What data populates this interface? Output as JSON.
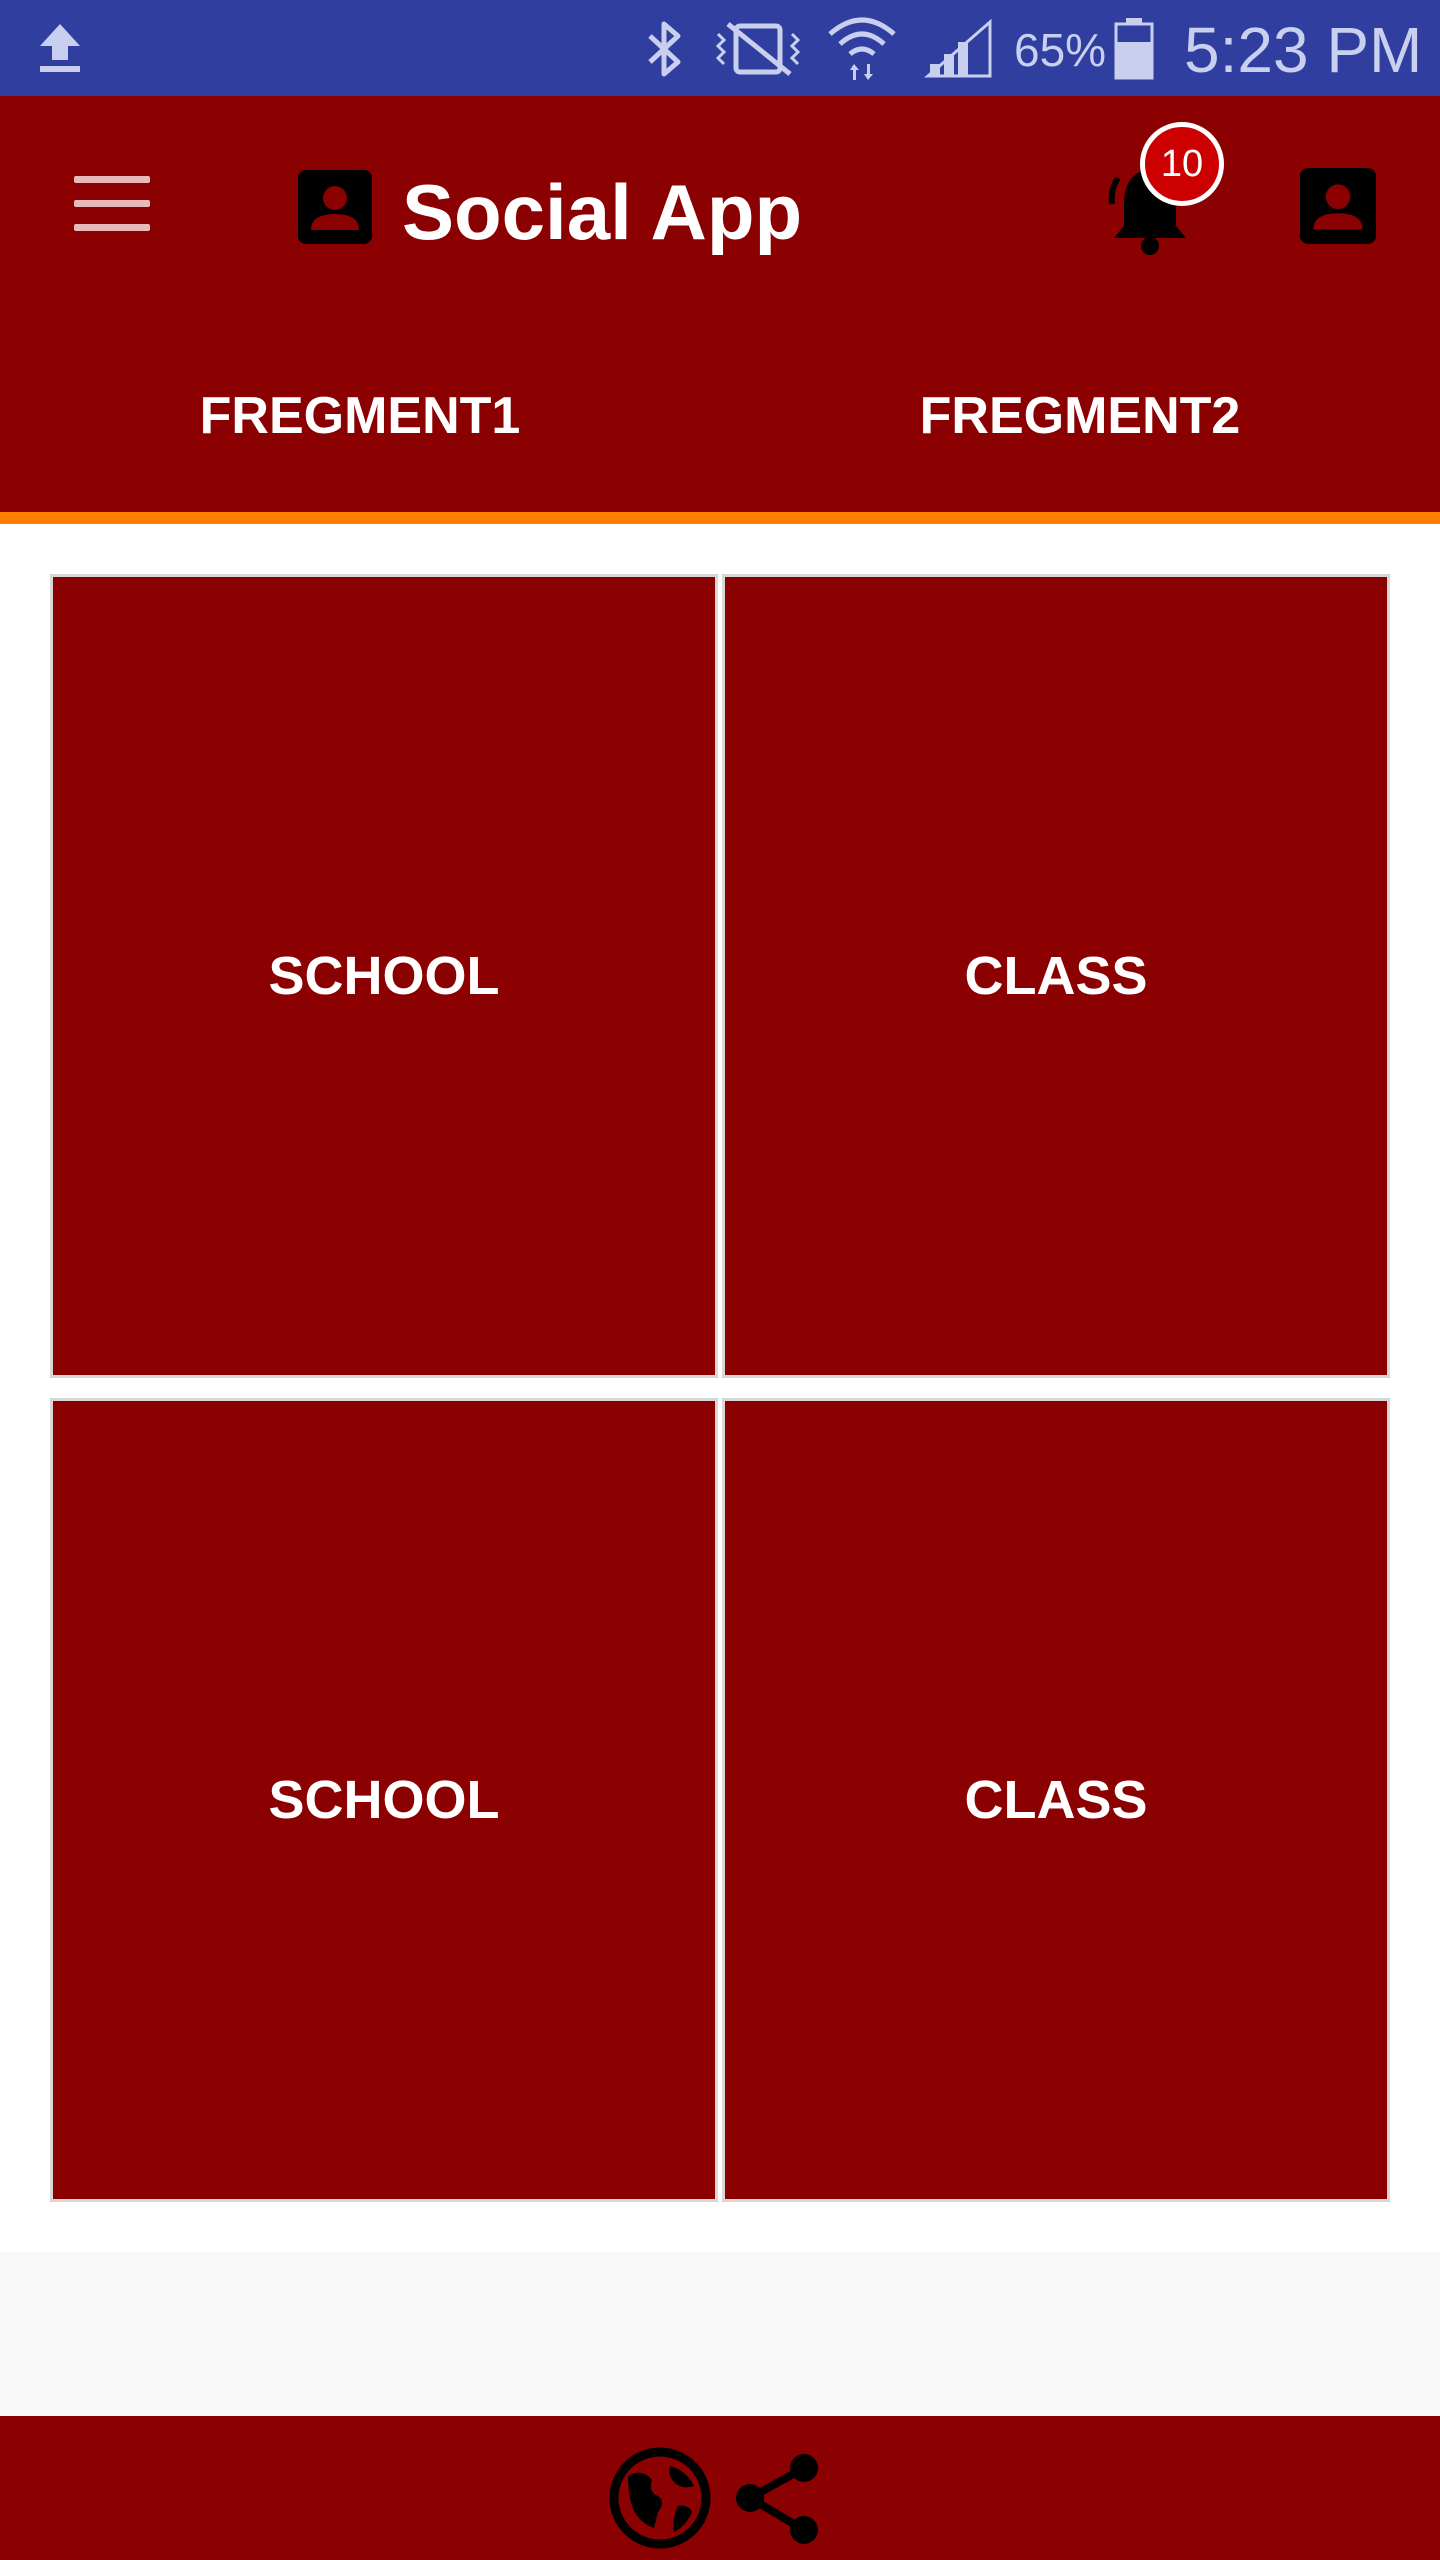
{
  "status_bar": {
    "battery_percent": "65%",
    "time": "5:23 PM",
    "icons": [
      "upload-icon",
      "bluetooth-icon",
      "vibrate-icon",
      "wifi-icon",
      "signal-icon",
      "battery-icon"
    ]
  },
  "toolbar": {
    "title": "Social App",
    "notification_count": "10",
    "icons": [
      "menu-icon",
      "contact-icon",
      "bell-icon",
      "profile-icon"
    ]
  },
  "tabs": [
    {
      "label": "FREGMENT1"
    },
    {
      "label": "FREGMENT2"
    }
  ],
  "grid": {
    "tiles": [
      {
        "label": "SCHOOL"
      },
      {
        "label": "CLASS"
      },
      {
        "label": "SCHOOL"
      },
      {
        "label": "CLASS"
      }
    ]
  },
  "bottom_bar": {
    "icons": [
      "globe-icon",
      "share-icon"
    ]
  },
  "colors": {
    "status_bar": "#303f9f",
    "primary": "#8b0000",
    "tab_indicator": "#ff7f00",
    "badge": "#cc0000",
    "tile_text": "#ffffff"
  }
}
